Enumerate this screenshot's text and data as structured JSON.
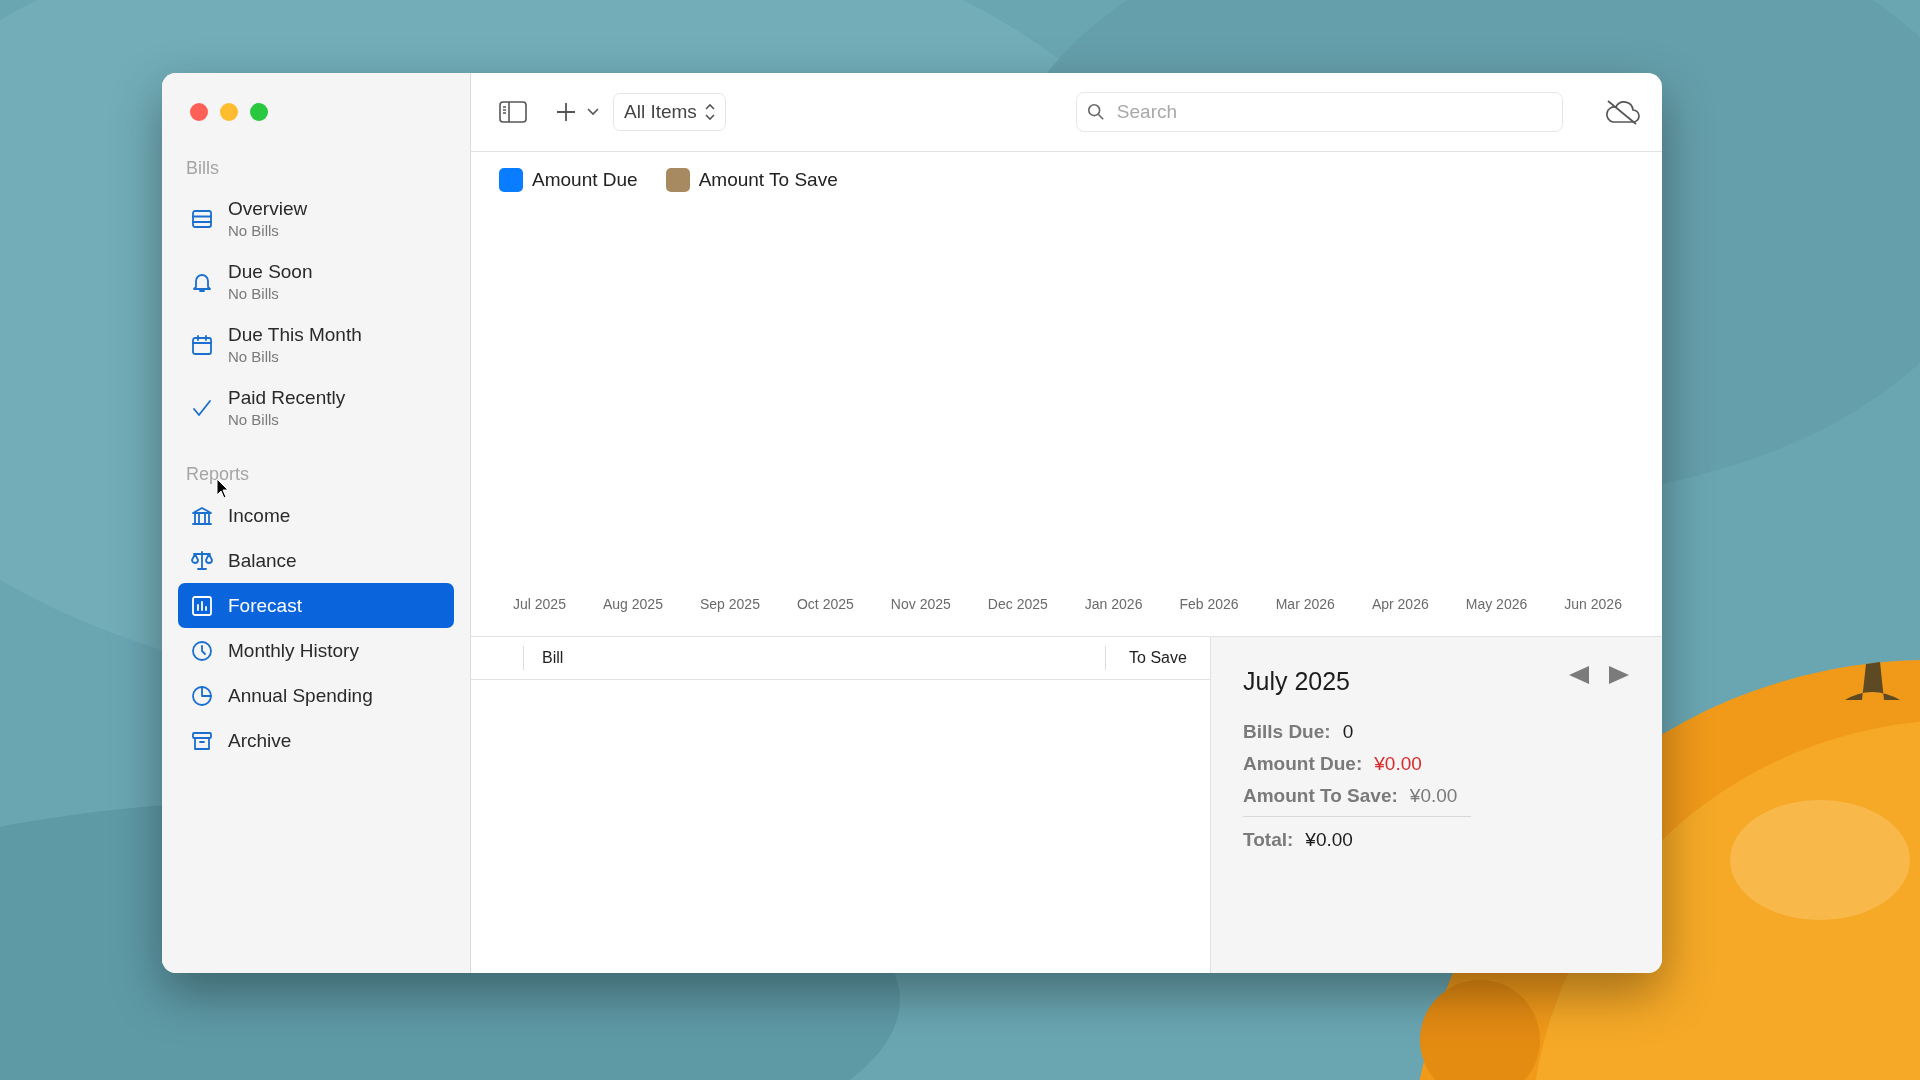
{
  "sidebar": {
    "sections": [
      {
        "title": "Bills",
        "items": [
          {
            "label": "Overview",
            "subtitle": "No Bills",
            "selected": false
          },
          {
            "label": "Due Soon",
            "subtitle": "No Bills",
            "selected": false
          },
          {
            "label": "Due This Month",
            "subtitle": "No Bills",
            "selected": false
          },
          {
            "label": "Paid Recently",
            "subtitle": "No Bills",
            "selected": false
          }
        ]
      },
      {
        "title": "Reports",
        "items": [
          {
            "label": "Income",
            "selected": false
          },
          {
            "label": "Balance",
            "selected": false
          },
          {
            "label": "Forecast",
            "selected": true
          },
          {
            "label": "Monthly History",
            "selected": false
          },
          {
            "label": "Annual Spending",
            "selected": false
          },
          {
            "label": "Archive",
            "selected": false
          }
        ]
      }
    ]
  },
  "toolbar": {
    "filter": "All Items",
    "search": {
      "placeholder": "Search"
    }
  },
  "chart": {
    "legend": [
      {
        "label": "Amount Due",
        "color": "#0a7cff"
      },
      {
        "label": "Amount To Save",
        "color": "#a88a60"
      }
    ],
    "months": [
      "Jul 2025",
      "Aug 2025",
      "Sep 2025",
      "Oct 2025",
      "Nov 2025",
      "Dec 2025",
      "Jan 2026",
      "Feb 2026",
      "Mar 2026",
      "Apr 2026",
      "May 2026",
      "Jun 2026"
    ]
  },
  "table": {
    "columns": [
      "Bill",
      "To Save"
    ]
  },
  "details": {
    "title": "July 2025",
    "rows": [
      {
        "kind": "line",
        "label": "Bills Due:",
        "value": "0",
        "color": "#1d1d1f"
      },
      {
        "kind": "line",
        "label": "Amount Due:",
        "value": "¥0.00",
        "color": "#d92b2b"
      },
      {
        "kind": "line",
        "label": "Amount To Save:",
        "value": "¥0.00",
        "color": "#7a7a7a"
      },
      {
        "kind": "total",
        "label": "Total:",
        "value": "¥0.00",
        "color": "#1d1d1f"
      }
    ]
  }
}
